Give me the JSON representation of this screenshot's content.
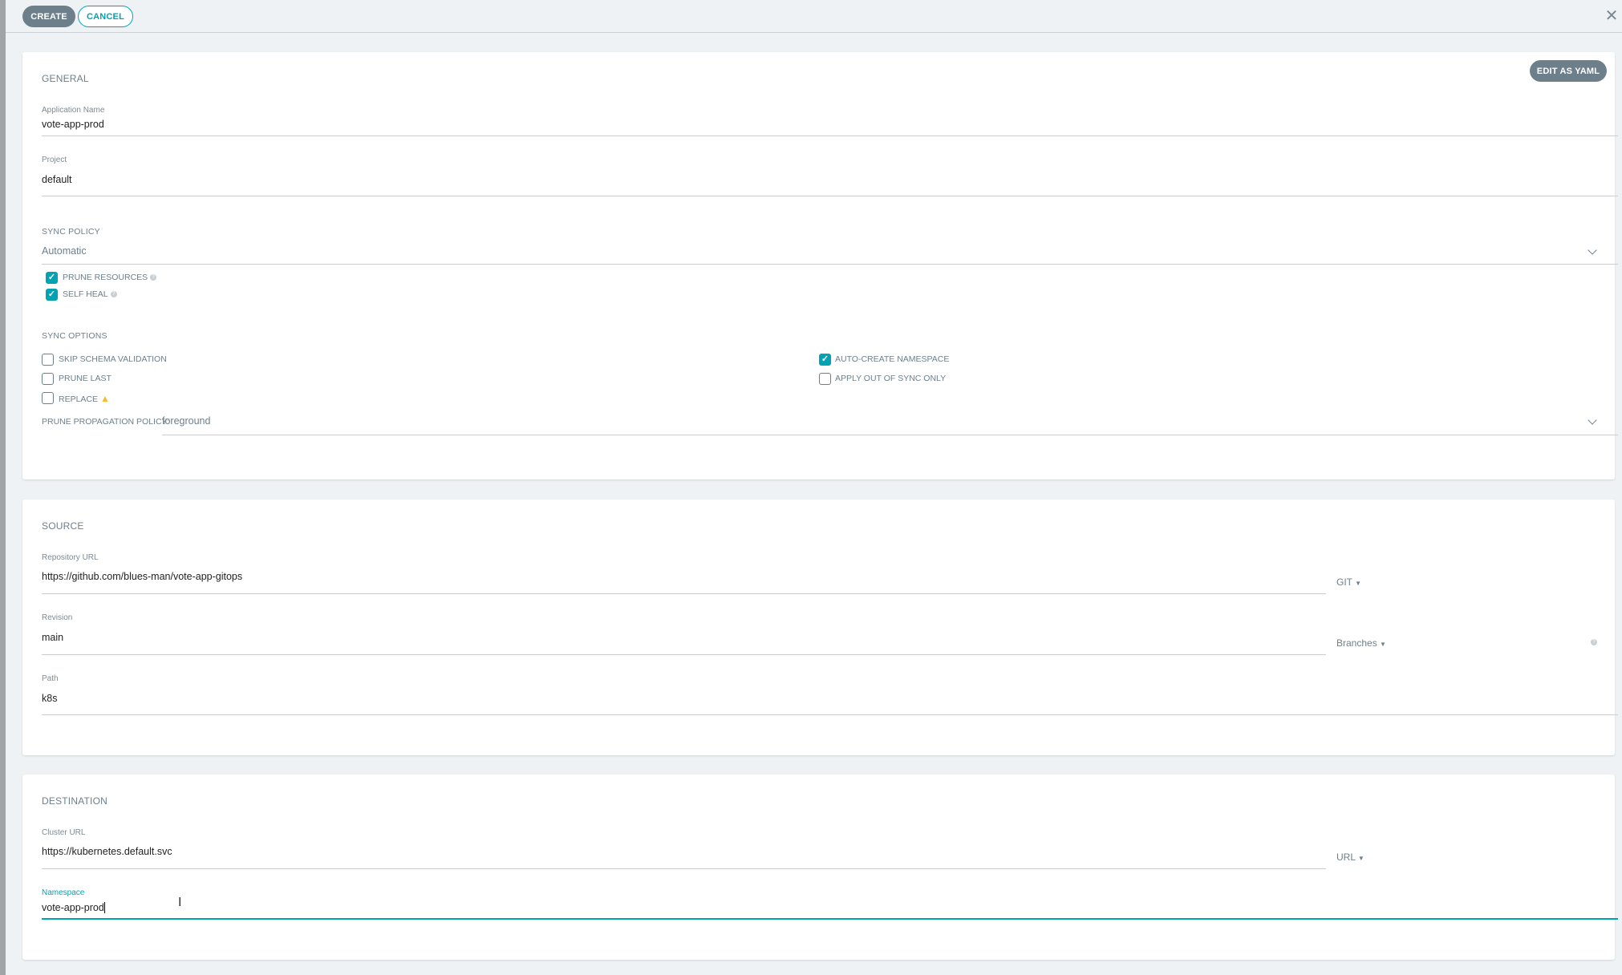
{
  "toolbar": {
    "create": "CREATE",
    "cancel": "CANCEL"
  },
  "general": {
    "title": "GENERAL",
    "edit_yaml": "EDIT AS YAML",
    "app_name_label": "Application Name",
    "app_name": "vote-app-prod",
    "project_label": "Project",
    "project": "default",
    "sync_policy_title": "SYNC POLICY",
    "sync_policy": "Automatic",
    "prune_resources": {
      "label": "PRUNE RESOURCES",
      "checked": true
    },
    "self_heal": {
      "label": "SELF HEAL",
      "checked": true
    },
    "sync_options_title": "SYNC OPTIONS",
    "options": [
      {
        "label": "SKIP SCHEMA VALIDATION",
        "checked": false
      },
      {
        "label": "PRUNE LAST",
        "checked": false
      },
      {
        "label": "REPLACE",
        "checked": false
      },
      {
        "label": "AUTO-CREATE NAMESPACE",
        "checked": true
      },
      {
        "label": "APPLY OUT OF SYNC ONLY",
        "checked": false
      }
    ],
    "prune_policy_label": "PRUNE PROPAGATION POLICY:",
    "prune_policy": "foreground"
  },
  "source": {
    "title": "SOURCE",
    "repo_label": "Repository URL",
    "repo": "https://github.com/blues-man/vote-app-gitops",
    "repo_type": "GIT",
    "revision_label": "Revision",
    "revision": "main",
    "revision_type": "Branches",
    "path_label": "Path",
    "path": "k8s"
  },
  "destination": {
    "title": "DESTINATION",
    "cluster_label": "Cluster URL",
    "cluster": "https://kubernetes.default.svc",
    "cluster_type": "URL",
    "namespace_label": "Namespace",
    "namespace": "vote-app-prod"
  },
  "colors": {
    "accent": "#00a2b3",
    "button": "#6d7f8b",
    "warning": "#f4c030"
  }
}
